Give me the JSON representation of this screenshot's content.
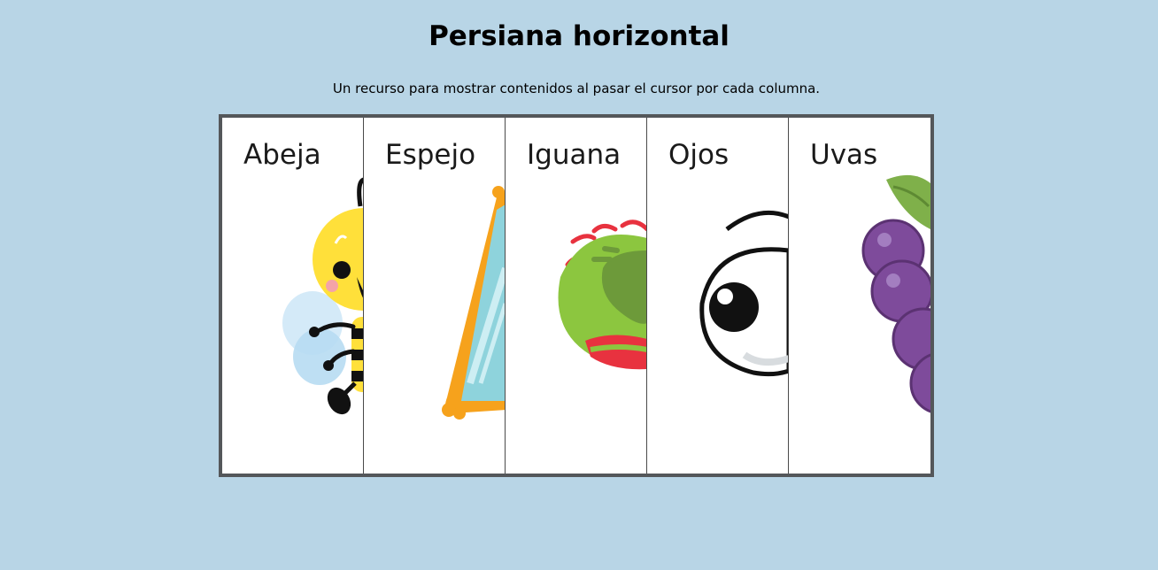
{
  "page": {
    "title": "Persiana horizontal",
    "subtitle": "Un recurso para mostrar contenidos al pasar el cursor por cada columna."
  },
  "columns": [
    {
      "label": "Abeja",
      "icon": "bee-icon"
    },
    {
      "label": "Espejo",
      "icon": "mirror-icon"
    },
    {
      "label": "Iguana",
      "icon": "iguana-icon"
    },
    {
      "label": "Ojos",
      "icon": "eye-icon"
    },
    {
      "label": "Uvas",
      "icon": "grapes-icon"
    }
  ],
  "colors": {
    "background": "#b8d5e6",
    "frame": "#54575a",
    "panel": "#ffffff"
  }
}
